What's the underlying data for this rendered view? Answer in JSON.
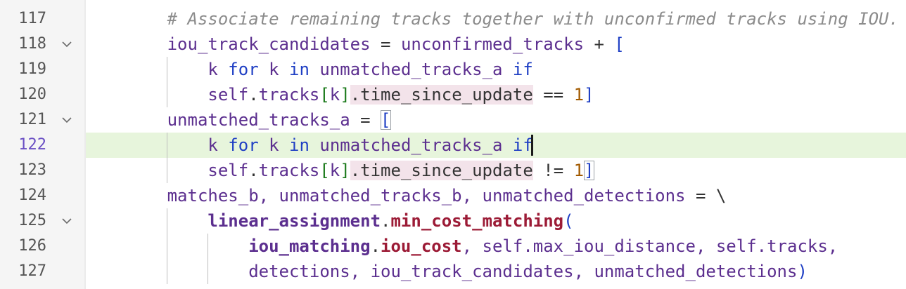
{
  "colors": {
    "gutter_background": "#f5f5f5",
    "current_line_highlight": "#e7f5dc",
    "current_line_number": "#6a4fc4",
    "comment": "#8c8c8c",
    "variable": "#5c2f8f",
    "keyword": "#1f3fc4",
    "function": "#9c1b36",
    "number": "#a25a00",
    "reference_highlight": "#f3e3ea"
  },
  "editor": {
    "current_line": 122,
    "lines": [
      {
        "number": "117",
        "tokens": [
          {
            "text": "        "
          },
          {
            "text": "# Associate remaining tracks together with unconfirmed tracks using IOU."
          }
        ]
      },
      {
        "number": "118",
        "tokens": [
          {
            "text": "        "
          },
          {
            "text": "iou_track_candidates"
          },
          {
            "text": " = "
          },
          {
            "text": "unconfirmed_tracks"
          },
          {
            "text": " + "
          },
          {
            "text": "["
          }
        ]
      },
      {
        "number": "119",
        "tokens": [
          {
            "text": "            "
          },
          {
            "text": "k"
          },
          {
            "text": " "
          },
          {
            "text": "for"
          },
          {
            "text": " "
          },
          {
            "text": "k"
          },
          {
            "text": " "
          },
          {
            "text": "in"
          },
          {
            "text": " "
          },
          {
            "text": "unmatched_tracks_a"
          },
          {
            "text": " "
          },
          {
            "text": "if"
          }
        ]
      },
      {
        "number": "120",
        "tokens": [
          {
            "text": "            "
          },
          {
            "text": "self"
          },
          {
            "text": "."
          },
          {
            "text": "tracks"
          },
          {
            "text": "["
          },
          {
            "text": "k"
          },
          {
            "text": "]"
          },
          {
            "text": ".time_since_update"
          },
          {
            "text": " == "
          },
          {
            "text": "1"
          },
          {
            "text": "]"
          }
        ]
      },
      {
        "number": "121",
        "tokens": [
          {
            "text": "        "
          },
          {
            "text": "unmatched_tracks_a"
          },
          {
            "text": " = "
          },
          {
            "text": "["
          }
        ]
      },
      {
        "number": "122",
        "tokens": [
          {
            "text": "            "
          },
          {
            "text": "k"
          },
          {
            "text": " "
          },
          {
            "text": "for"
          },
          {
            "text": " "
          },
          {
            "text": "k"
          },
          {
            "text": " "
          },
          {
            "text": "in"
          },
          {
            "text": " "
          },
          {
            "text": "unmatched_tracks_a"
          },
          {
            "text": " "
          },
          {
            "text": "if"
          }
        ]
      },
      {
        "number": "123",
        "tokens": [
          {
            "text": "            "
          },
          {
            "text": "self"
          },
          {
            "text": "."
          },
          {
            "text": "tracks"
          },
          {
            "text": "["
          },
          {
            "text": "k"
          },
          {
            "text": "]"
          },
          {
            "text": ".time_since_update"
          },
          {
            "text": " != "
          },
          {
            "text": "1"
          },
          {
            "text": "]"
          }
        ]
      },
      {
        "number": "124",
        "tokens": [
          {
            "text": "        "
          },
          {
            "text": "matches_b, unmatched_tracks_b, unmatched_detections"
          },
          {
            "text": " = \\"
          }
        ]
      },
      {
        "number": "125",
        "tokens": [
          {
            "text": "            "
          },
          {
            "text": "linear_assignment"
          },
          {
            "text": "."
          },
          {
            "text": "min_cost_matching"
          },
          {
            "text": "("
          }
        ]
      },
      {
        "number": "126",
        "tokens": [
          {
            "text": "                "
          },
          {
            "text": "iou_matching"
          },
          {
            "text": "."
          },
          {
            "text": "iou_cost"
          },
          {
            "text": ", self.max_iou_distance, self.tracks,"
          }
        ]
      },
      {
        "number": "127",
        "tokens": [
          {
            "text": "                "
          },
          {
            "text": "detections, iou_track_candidates, unmatched_detections"
          },
          {
            "text": ")"
          }
        ]
      }
    ]
  },
  "icons": {
    "fold": "chevron-down-icon"
  }
}
